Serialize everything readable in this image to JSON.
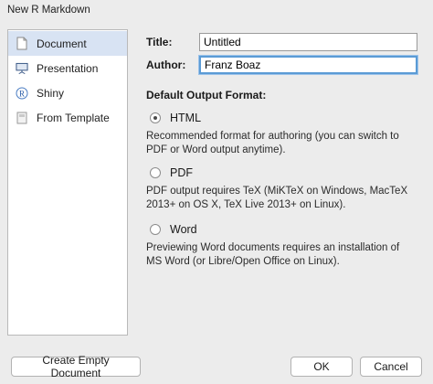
{
  "window": {
    "title": "New R Markdown"
  },
  "sidebar": {
    "items": [
      {
        "label": "Document",
        "icon": "document-icon",
        "selected": true
      },
      {
        "label": "Presentation",
        "icon": "presentation-icon",
        "selected": false
      },
      {
        "label": "Shiny",
        "icon": "shiny-icon",
        "selected": false
      },
      {
        "label": "From Template",
        "icon": "template-icon",
        "selected": false
      }
    ]
  },
  "form": {
    "title_label": "Title:",
    "title_value": "Untitled",
    "author_label": "Author:",
    "author_value": "Franz Boaz"
  },
  "output_format": {
    "heading": "Default Output Format:",
    "options": [
      {
        "label": "HTML",
        "checked": true,
        "description": "Recommended format for authoring (you can switch to PDF or Word output anytime)."
      },
      {
        "label": "PDF",
        "checked": false,
        "description": "PDF output requires TeX (MiKTeX on Windows, MacTeX 2013+ on OS X, TeX Live 2013+ on Linux)."
      },
      {
        "label": "Word",
        "checked": false,
        "description": "Previewing Word documents requires an installation of MS Word (or Libre/Open Office on Linux)."
      }
    ]
  },
  "buttons": {
    "create_empty": "Create Empty Document",
    "ok": "OK",
    "cancel": "Cancel"
  },
  "colors": {
    "selection": "#d8e3f3",
    "focus": "#5b9bd5"
  }
}
